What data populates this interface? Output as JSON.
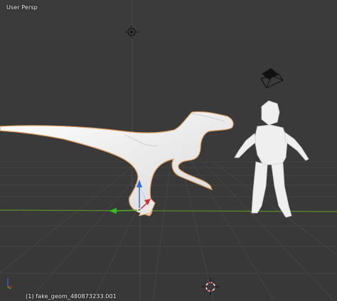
{
  "viewport": {
    "view_label": "User Persp",
    "object_info": "(1) fake_geom_480873233.001"
  },
  "colors": {
    "background": "#3a3a3a",
    "grid_line": "#474747",
    "x_axis": "#5b8e2a",
    "y_axis": "#7a3e3e",
    "selection_outline": "#e0a060",
    "mesh": "#f2f2f2"
  },
  "icons": {
    "light": "light-icon",
    "camera": "camera-icon",
    "cursor_3d": "3d-cursor-icon",
    "gizmo": "transform-gizmo-icon",
    "axis_widget": "axis-orientation-icon"
  }
}
